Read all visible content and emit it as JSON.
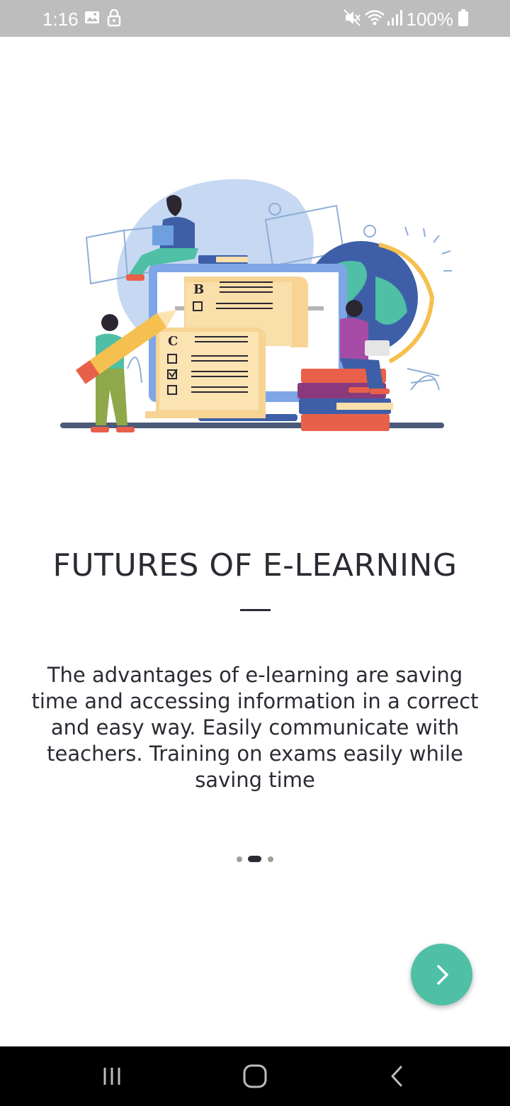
{
  "status_bar": {
    "time": "1:16",
    "battery_percent": "100%",
    "icons": [
      "image-icon",
      "lock-icon",
      "mute-icon",
      "wifi-icon",
      "signal-icon",
      "battery-icon"
    ]
  },
  "onboarding": {
    "title": "FUTURES OF E-LEARNING",
    "description": "The advantages of e-learning are saving time and accessing information in a correct and easy way. Easily communicate with teachers. Training on exams easily while saving time",
    "page_index": 2,
    "page_count": 3,
    "next_icon": "chevron-right-icon",
    "accent_color": "#4fbfa5"
  },
  "nav_bar": {
    "icons": [
      "recent-apps-icon",
      "home-icon",
      "back-icon"
    ]
  }
}
